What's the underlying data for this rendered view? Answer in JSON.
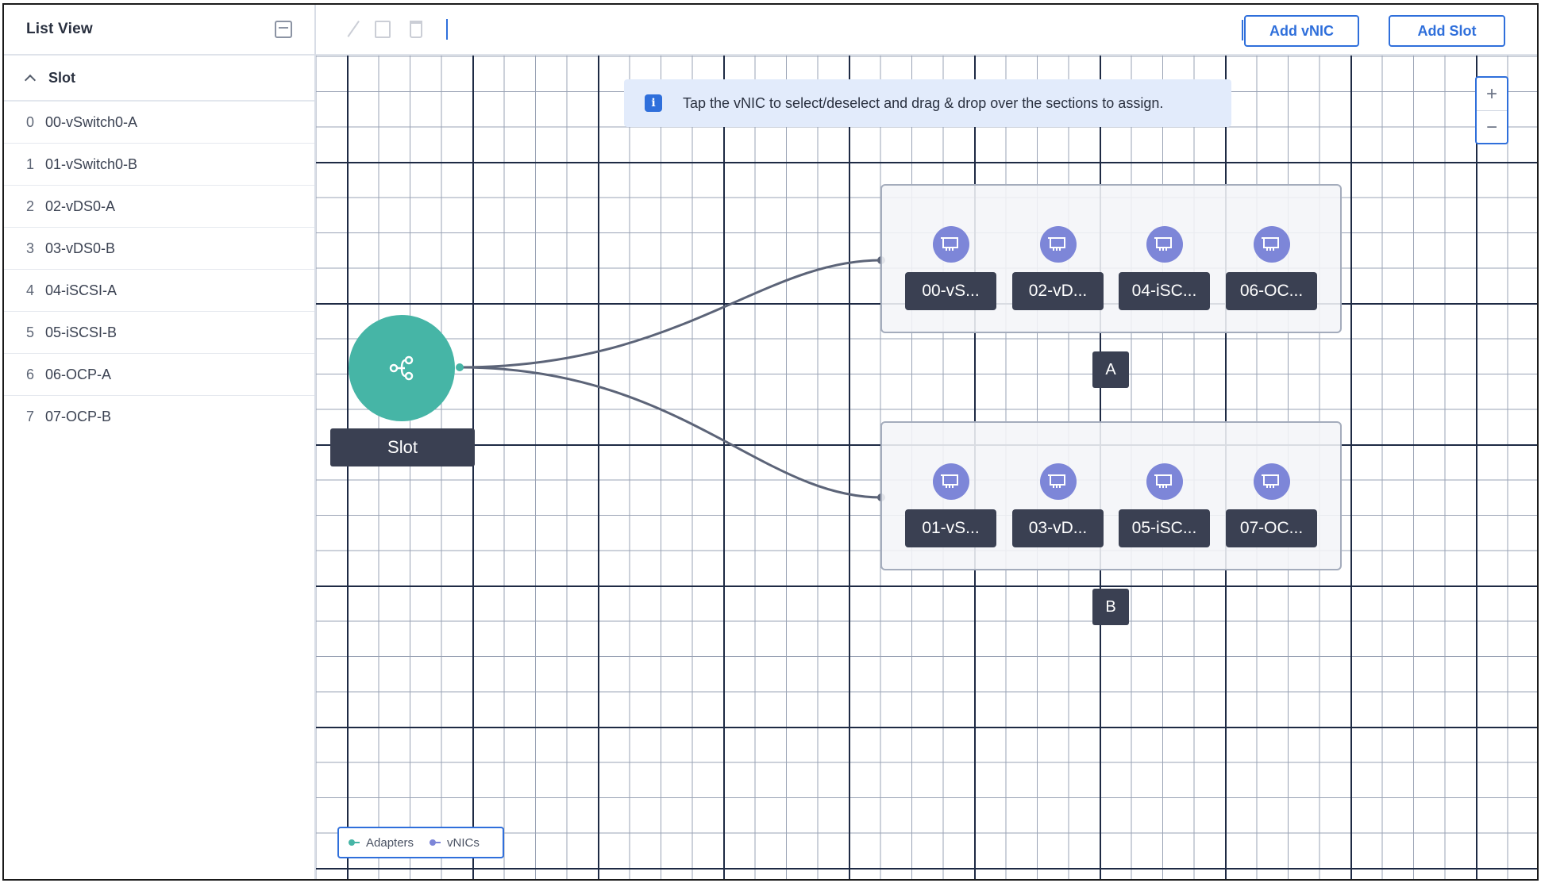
{
  "sidebar": {
    "title": "List View",
    "group_label": "Slot",
    "items": [
      {
        "index": "0",
        "label": "00-vSwitch0-A"
      },
      {
        "index": "1",
        "label": "01-vSwitch0-B"
      },
      {
        "index": "2",
        "label": "02-vDS0-A"
      },
      {
        "index": "3",
        "label": "03-vDS0-B"
      },
      {
        "index": "4",
        "label": "04-iSCSI-A"
      },
      {
        "index": "5",
        "label": "05-iSCSI-B"
      },
      {
        "index": "6",
        "label": "06-OCP-A"
      },
      {
        "index": "7",
        "label": "07-OCP-B"
      }
    ]
  },
  "toolbar": {
    "add_vnic_label": "Add vNIC",
    "add_slot_label": "Add Slot"
  },
  "info_banner": {
    "text": "Tap the vNIC to select/deselect and drag & drop over the sections to assign."
  },
  "zoom": {
    "plus": "+",
    "minus": "−"
  },
  "topology": {
    "slot_label": "Slot",
    "section_a": {
      "label": "A",
      "vnics": [
        "00-vS...",
        "02-vD...",
        "04-iSC...",
        "06-OC..."
      ]
    },
    "section_b": {
      "label": "B",
      "vnics": [
        "01-vS...",
        "03-vD...",
        "05-iSC...",
        "07-OC..."
      ]
    }
  },
  "legend": {
    "adapters_label": "Adapters",
    "vnics_label": "vNICs"
  },
  "colors": {
    "accent": "#2f6fdb",
    "slot_node": "#46b5a6",
    "vnic_icon": "#7d86d8",
    "chip": "#3a4052"
  }
}
